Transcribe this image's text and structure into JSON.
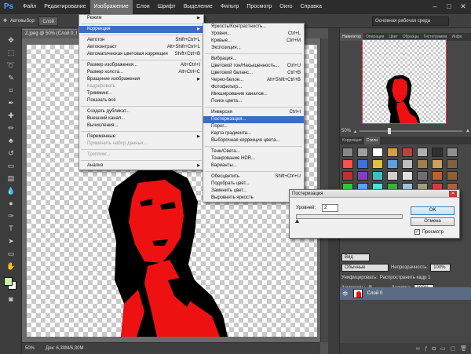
{
  "app": {
    "logo": "Ps"
  },
  "menubar": {
    "items": [
      "Файл",
      "Редактирование",
      "Изображение",
      "Слои",
      "Шрифт",
      "Выделение",
      "Фильтр",
      "Просмотр",
      "Окно",
      "Справка"
    ],
    "active_index": 2
  },
  "window_controls": {
    "minimize": "–",
    "maximize": "□",
    "close": "✕"
  },
  "options_bar": {
    "autoselect_label": "Автовыбор:",
    "autoselect_value": "Слой",
    "workspace": "Основная рабочая среда"
  },
  "document": {
    "tab_label": "Z.jpeg @ 50% (Слой 0, RGB/8) *",
    "zoom": "50%",
    "doc_size": "Док: 6,30М/6,30М"
  },
  "image_menu": {
    "rows": [
      {
        "label": "Режим",
        "shortcut": "",
        "arrow": "▶",
        "state": "normal"
      },
      {
        "sep": true
      },
      {
        "label": "Коррекция",
        "shortcut": "",
        "arrow": "▶",
        "state": "highlight"
      },
      {
        "sep": true
      },
      {
        "label": "Автотон",
        "shortcut": "Shift+Ctrl+L",
        "arrow": "",
        "state": "normal"
      },
      {
        "label": "Автоконтраст",
        "shortcut": "Alt+Shift+Ctrl+L",
        "arrow": "",
        "state": "normal"
      },
      {
        "label": "Автоматическая цветовая коррекция",
        "shortcut": "Shift+Ctrl+B",
        "arrow": "",
        "state": "normal"
      },
      {
        "sep": true
      },
      {
        "label": "Размер изображения...",
        "shortcut": "Alt+Ctrl+I",
        "arrow": "",
        "state": "normal"
      },
      {
        "label": "Размер холста...",
        "shortcut": "Alt+Ctrl+C",
        "arrow": "",
        "state": "normal"
      },
      {
        "label": "Вращение изображения",
        "shortcut": "",
        "arrow": "▶",
        "state": "normal"
      },
      {
        "label": "Кадрировать",
        "shortcut": "",
        "arrow": "",
        "state": "disabled"
      },
      {
        "label": "Тримминг...",
        "shortcut": "",
        "arrow": "",
        "state": "normal"
      },
      {
        "label": "Показать все",
        "shortcut": "",
        "arrow": "",
        "state": "normal"
      },
      {
        "sep": true
      },
      {
        "label": "Создать дубликат...",
        "shortcut": "",
        "arrow": "",
        "state": "normal"
      },
      {
        "label": "Внешний канал...",
        "shortcut": "",
        "arrow": "",
        "state": "normal"
      },
      {
        "label": "Вычисления...",
        "shortcut": "",
        "arrow": "",
        "state": "normal"
      },
      {
        "sep": true
      },
      {
        "label": "Переменные",
        "shortcut": "",
        "arrow": "▶",
        "state": "normal"
      },
      {
        "label": "Применить набор данных...",
        "shortcut": "",
        "arrow": "",
        "state": "disabled"
      },
      {
        "sep": true
      },
      {
        "label": "Треппинг...",
        "shortcut": "",
        "arrow": "",
        "state": "disabled"
      },
      {
        "sep": true
      },
      {
        "label": "Анализ",
        "shortcut": "",
        "arrow": "▶",
        "state": "normal"
      }
    ]
  },
  "adjust_menu": {
    "rows": [
      {
        "label": "Яркость/Контрастность...",
        "shortcut": "",
        "state": "normal"
      },
      {
        "label": "Уровни...",
        "shortcut": "Ctrl+L",
        "state": "normal"
      },
      {
        "label": "Кривые...",
        "shortcut": "Ctrl+M",
        "state": "normal"
      },
      {
        "label": "Экспозиция...",
        "shortcut": "",
        "state": "normal"
      },
      {
        "sep": true
      },
      {
        "label": "Вибрация...",
        "shortcut": "",
        "state": "normal"
      },
      {
        "label": "Цветовой тон/Насыщенность...",
        "shortcut": "Ctrl+U",
        "state": "normal"
      },
      {
        "label": "Цветовой баланс...",
        "shortcut": "Ctrl+B",
        "state": "normal"
      },
      {
        "label": "Черно-белое...",
        "shortcut": "Alt+Shift+Ctrl+B",
        "state": "normal"
      },
      {
        "label": "Фотофильтр...",
        "shortcut": "",
        "state": "normal"
      },
      {
        "label": "Микширование каналов...",
        "shortcut": "",
        "state": "normal"
      },
      {
        "label": "Поиск цвета...",
        "shortcut": "",
        "state": "normal"
      },
      {
        "sep": true
      },
      {
        "label": "Инверсия",
        "shortcut": "Ctrl+I",
        "state": "normal"
      },
      {
        "label": "Постеризация...",
        "shortcut": "",
        "state": "highlight"
      },
      {
        "label": "Порог...",
        "shortcut": "",
        "state": "normal"
      },
      {
        "label": "Карта градиента...",
        "shortcut": "",
        "state": "normal"
      },
      {
        "label": "Выборочная коррекция цвета...",
        "shortcut": "",
        "state": "normal"
      },
      {
        "sep": true
      },
      {
        "label": "Тени/Света...",
        "shortcut": "",
        "state": "normal"
      },
      {
        "label": "Тонирование HDR...",
        "shortcut": "",
        "state": "normal"
      },
      {
        "label": "Варианты...",
        "shortcut": "",
        "state": "normal"
      },
      {
        "sep": true
      },
      {
        "label": "Обесцветить",
        "shortcut": "Shift+Ctrl+U",
        "state": "normal"
      },
      {
        "label": "Подобрать цвет...",
        "shortcut": "",
        "state": "normal"
      },
      {
        "label": "Заменить цвет...",
        "shortcut": "",
        "state": "normal"
      },
      {
        "label": "Выровнять яркость",
        "shortcut": "",
        "state": "normal"
      }
    ]
  },
  "posterize_dialog": {
    "title": "Постеризация",
    "levels_label": "Уровней:",
    "levels_value": "2",
    "ok": "OK",
    "cancel": "Отмена",
    "preview_label": "Просмотр",
    "preview_checked": "✓"
  },
  "navigator": {
    "tabs": [
      "Навигатор",
      "Операции",
      "Цвет",
      "Образцы",
      "Гистограмма",
      "Инфо"
    ],
    "zoom": "50%"
  },
  "styles_panel": {
    "tabs": [
      "Коррекция",
      "Стили"
    ]
  },
  "layers_panel": {
    "kind": "Вид",
    "blend_mode": "Обычные",
    "opacity_label": "Непрозрачность:",
    "opacity": "100%",
    "unify_label": "Унифицировать:",
    "propagate_label": "Распространить кадр 1",
    "lock_label": "Закрепить:",
    "fill_label": "Заливка:",
    "fill": "100%",
    "layer_name": "Слой 0"
  },
  "colors": {
    "accent": "#3f6bc5",
    "fg_swatch": "#c7f4a0",
    "red": "#ee1111"
  },
  "style_swatches": [
    "#888888",
    "#a0a0a0",
    "#ffffff",
    "#d6a040",
    "#c04040",
    "#b0b0b0",
    "#303030",
    "#909090",
    "#ff5050",
    "#4070e0",
    "#e0c040",
    "#60a0e0",
    "#c0c0c0",
    "#a08050",
    "#d0a060",
    "#806040",
    "#c03030",
    "#8040c0",
    "#40c0c0",
    "#d0d0d0",
    "#e0e0e0",
    "#707070",
    "#c06030",
    "#906030",
    "#40c040",
    "#60a0ff",
    "#50e0e0",
    "#40b040",
    "#a0c0e0",
    "#a0a080",
    "#d04040",
    "#b06040",
    "#3070e0",
    "#2050c0",
    "#f0a040",
    "#a0a0a0",
    "#e08080",
    "#9090c0",
    "#e04040",
    "#b08060"
  ]
}
